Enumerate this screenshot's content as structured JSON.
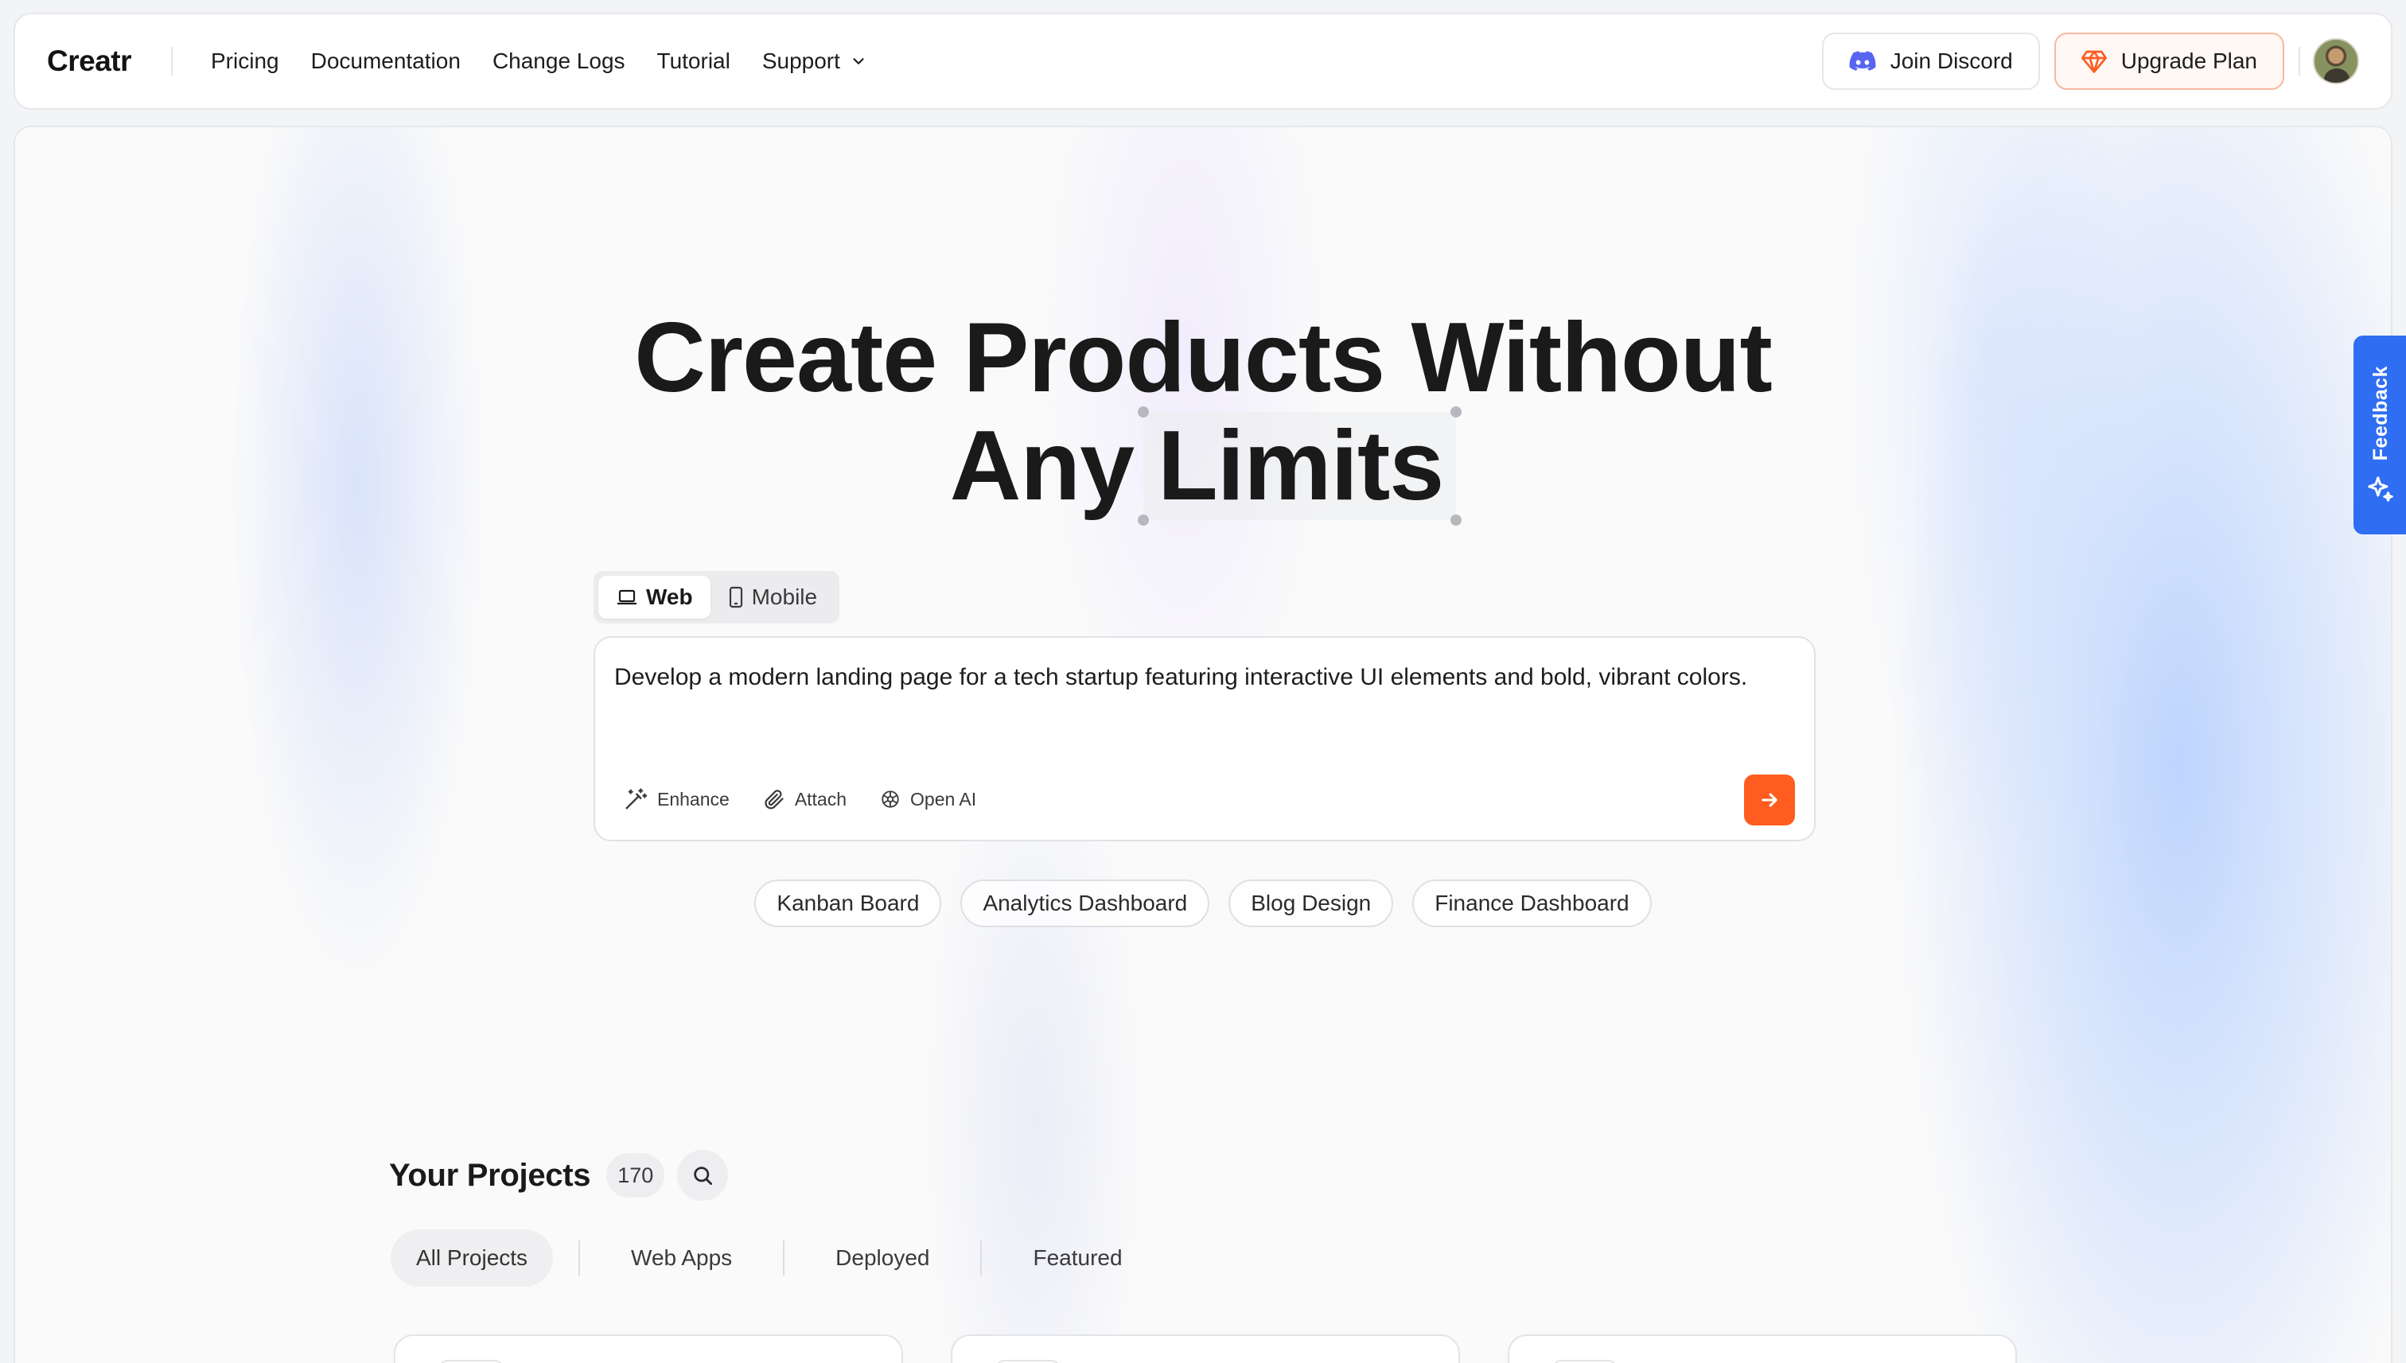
{
  "brand": "Creatr",
  "nav": {
    "links": [
      "Pricing",
      "Documentation",
      "Change Logs",
      "Tutorial"
    ],
    "support_label": "Support",
    "discord_label": "Join Discord",
    "upgrade_label": "Upgrade Plan"
  },
  "hero": {
    "line1": "Create Products Without",
    "line2_prefix": "Any",
    "line2_highlight": "Limits"
  },
  "device_toggle": {
    "web_label": "Web",
    "mobile_label": "Mobile",
    "selected": "Web"
  },
  "prompt": {
    "value": "Develop a modern landing page for a tech startup featuring interactive UI elements and bold, vibrant colors.",
    "tools": {
      "enhance": "Enhance",
      "attach": "Attach",
      "model": "Open AI"
    }
  },
  "suggestions": [
    "Kanban Board",
    "Analytics Dashboard",
    "Blog Design",
    "Finance Dashboard"
  ],
  "projects": {
    "title": "Your Projects",
    "count": "170",
    "filters": [
      "All Projects",
      "Web Apps",
      "Deployed",
      "Featured"
    ],
    "active_filter": "All Projects"
  },
  "feedback_label": "Feedback",
  "colors": {
    "accent_orange": "#ff5c1f",
    "feedback_blue": "#2f6ef3",
    "discord_purple": "#5865f2"
  }
}
